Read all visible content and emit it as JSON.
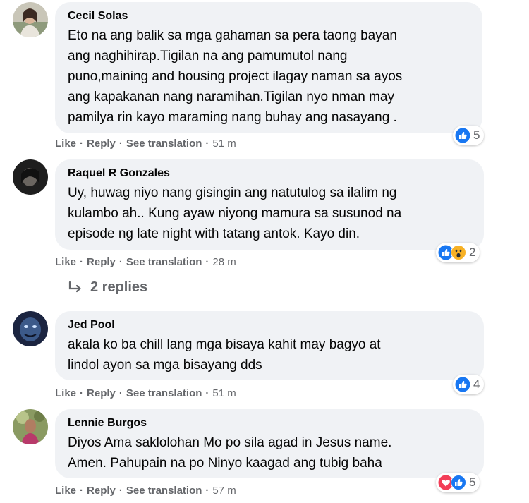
{
  "comments": [
    {
      "author": "Cecil Solas",
      "text": "Eto na ang balik sa mga gahaman sa pera taong bayan\nang naghihirap.Tigilan na ang pamumutol nang\npuno,maining and housing project ilagay naman sa ayos\nang kapakanan nang naramihan.Tigilan nyo nman may\npamilya rin kayo maraming nang buhay ang nasayang .",
      "like_label": "Like",
      "reply_label": "Reply",
      "translate_label": "See translation",
      "time": "51 m",
      "reaction_count": "5",
      "reactions": [
        "like"
      ]
    },
    {
      "author": "Raquel R Gonzales",
      "text": "Uy, huwag niyo nang gisingin ang natutulog sa ilalim ng\nkulambo ah.. Kung ayaw niyong mamura sa susunod na\nepisode ng late night with tatang antok. Kayo din.",
      "like_label": "Like",
      "reply_label": "Reply",
      "translate_label": "See translation",
      "time": "28 m",
      "reaction_count": "2",
      "reactions": [
        "like",
        "wow"
      ]
    },
    {
      "author": "Jed Pool",
      "text": "akala ko ba chill lang mga bisaya kahit may bagyo at\nlindol ayon sa mga bisayang dds",
      "like_label": "Like",
      "reply_label": "Reply",
      "translate_label": "See translation",
      "time": "51 m",
      "reaction_count": "4",
      "reactions": [
        "like"
      ]
    },
    {
      "author": "Lennie Burgos",
      "text": "Diyos Ama saklolohan Mo po sila agad in Jesus name.\nAmen. Pahupain na po Ninyo kaagad ang tubig baha",
      "like_label": "Like",
      "reply_label": "Reply",
      "translate_label": "See translation",
      "time": "57 m",
      "reaction_count": "5",
      "reactions": [
        "love",
        "like"
      ]
    }
  ],
  "replies_link": "2 replies",
  "colors": {
    "bubble": "#f0f2f5",
    "meta": "#65676b",
    "like_blue": "#1877f2",
    "love_red": "#f33e58",
    "wow_yellow": "#f7b125"
  }
}
